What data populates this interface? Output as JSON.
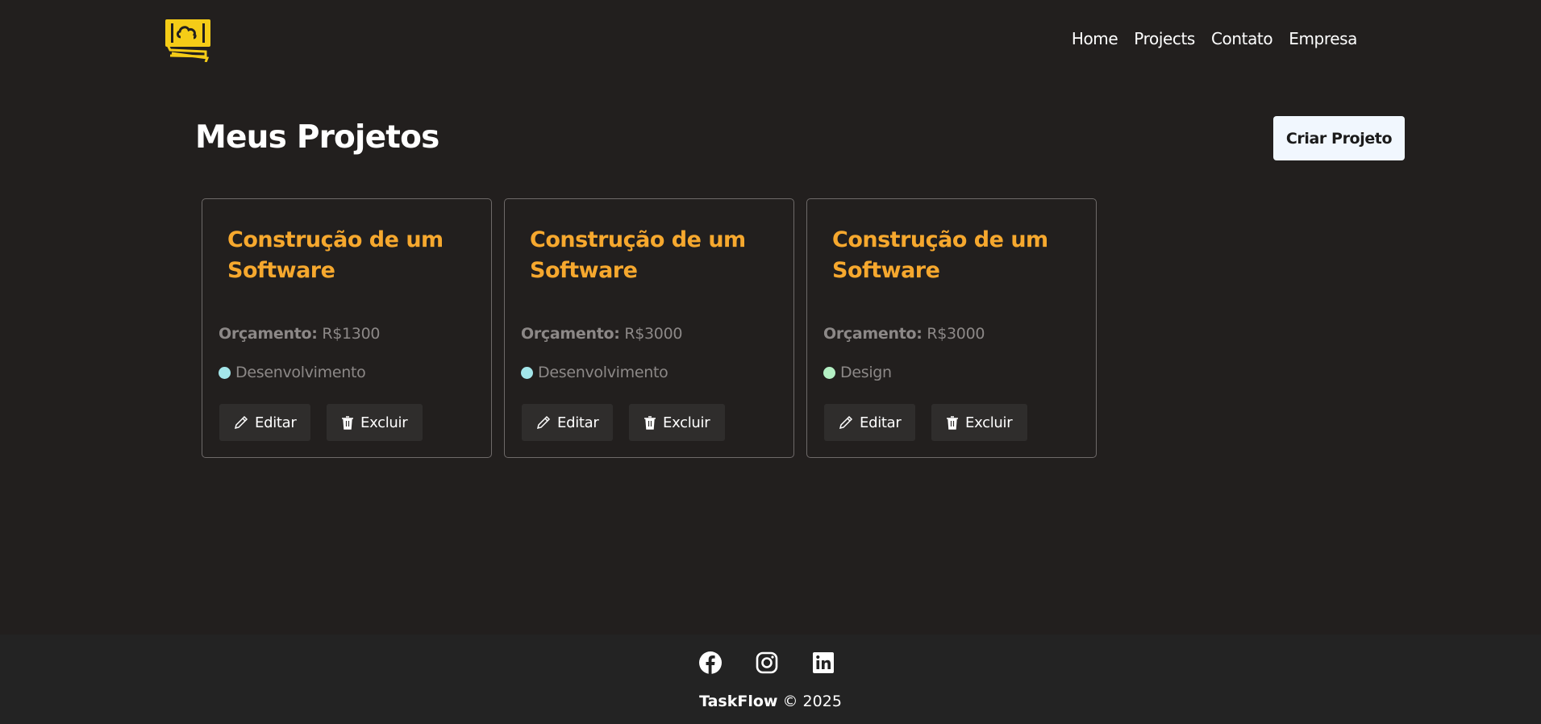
{
  "header": {
    "logo_alt": "logo",
    "nav": [
      "Home",
      "Projects",
      "Contato",
      "Empresa"
    ]
  },
  "main": {
    "title": "Meus Projetos",
    "create_label": "Criar Projeto"
  },
  "projects": [
    {
      "title": "Construção de um Software",
      "budget_label": "Orçamento:",
      "budget_value": "R$1300",
      "category": "Desenvolvimento",
      "category_color": "#a3e6ea",
      "edit_label": "Editar",
      "delete_label": "Excluir"
    },
    {
      "title": "Construção de um Software",
      "budget_label": "Orçamento:",
      "budget_value": "R$3000",
      "category": "Desenvolvimento",
      "category_color": "#a3e6ea",
      "edit_label": "Editar",
      "delete_label": "Excluir"
    },
    {
      "title": "Construção de um Software",
      "budget_label": "Orçamento:",
      "budget_value": "R$3000",
      "category": "Design",
      "category_color": "#b4f0c4",
      "edit_label": "Editar",
      "delete_label": "Excluir"
    }
  ],
  "footer": {
    "social_icons": [
      "facebook-icon",
      "instagram-icon",
      "linkedin-icon"
    ],
    "brand": "TaskFlow",
    "copyright": " © 2025"
  },
  "colors": {
    "background": "#221f1e",
    "accent": "#f6a82e",
    "logo": "#f5cc17"
  }
}
